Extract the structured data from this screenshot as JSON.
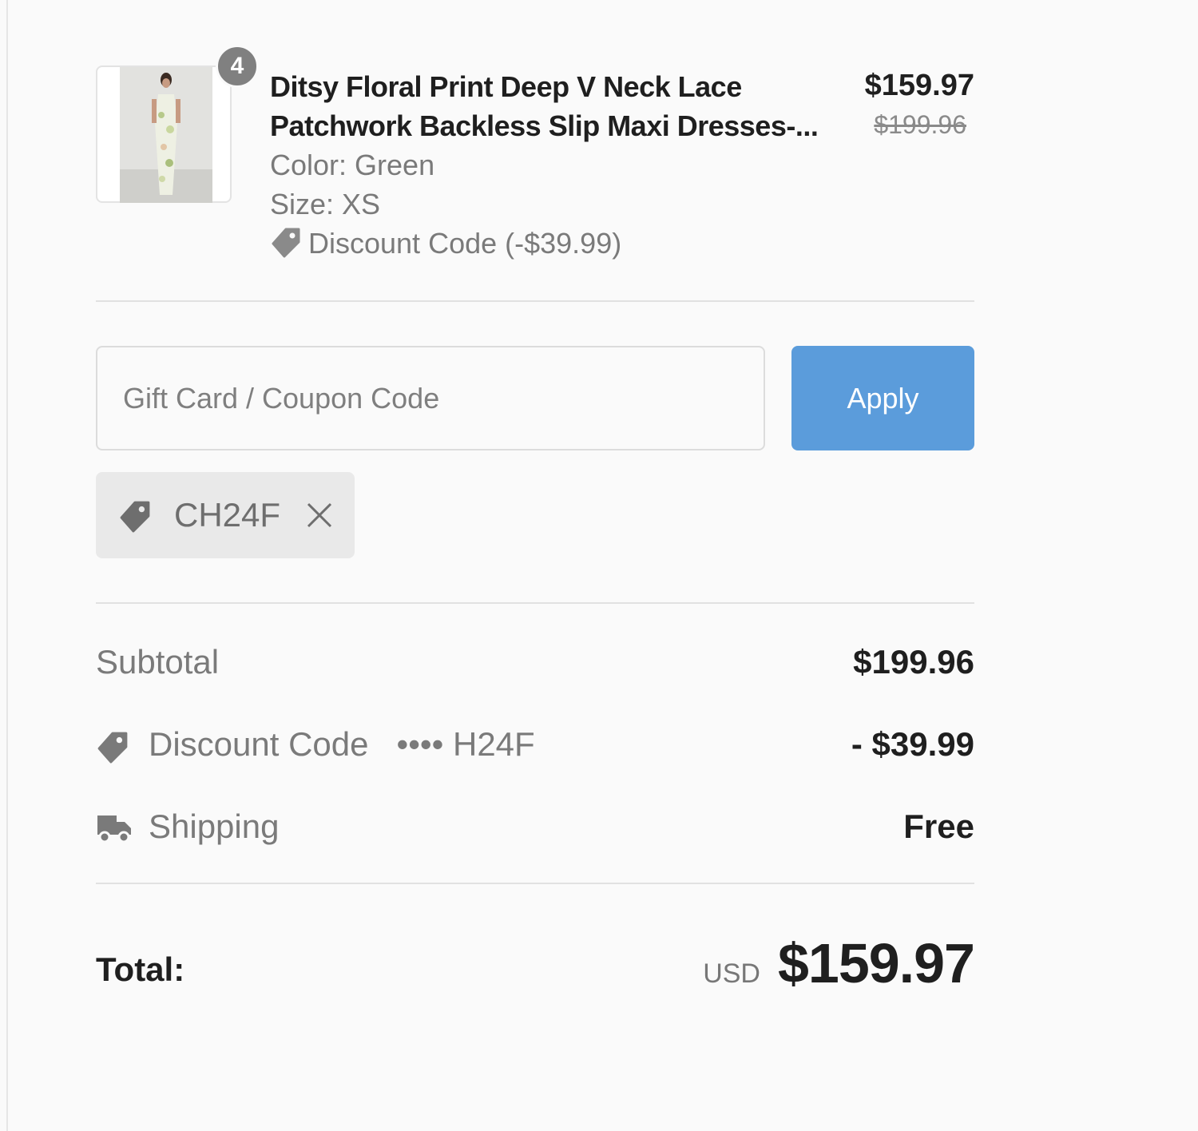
{
  "product": {
    "quantity": "4",
    "title_line1": "Ditsy Floral Print Deep V Neck Lace",
    "title_line2": "Patchwork Backless Slip Maxi Dresses-...",
    "color": "Color: Green",
    "size": "Size: XS",
    "discount": "Discount Code (-$39.99)",
    "price": "$159.97",
    "original_price": "$199.96"
  },
  "coupon": {
    "placeholder": "Gift Card / Coupon Code",
    "apply_label": "Apply",
    "applied_code": "CH24F"
  },
  "summary": {
    "subtotal_label": "Subtotal",
    "subtotal_value": "$199.96",
    "discount_label": "Discount Code",
    "discount_code_masked": "•••• H24F",
    "discount_value": "- $39.99",
    "shipping_label": "Shipping",
    "shipping_value": "Free"
  },
  "total": {
    "label": "Total:",
    "currency": "USD",
    "value": "$159.97"
  },
  "colors": {
    "accent": "#5b9cdb",
    "text_dark": "#1f1f1f",
    "text_muted": "#7a7a7a"
  }
}
